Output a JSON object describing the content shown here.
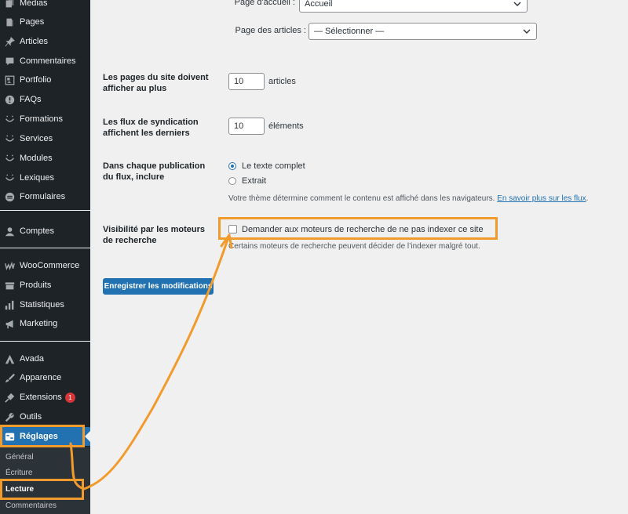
{
  "sidebar": {
    "items": [
      {
        "label": "Médias",
        "icon": "media-icon"
      },
      {
        "label": "Pages",
        "icon": "pages-icon"
      },
      {
        "label": "Articles",
        "icon": "pin-icon"
      },
      {
        "label": "Commentaires",
        "icon": "comment-icon"
      },
      {
        "label": "Portfolio",
        "icon": "portfolio-icon"
      },
      {
        "label": "FAQs",
        "icon": "info-icon"
      },
      {
        "label": "Formations",
        "icon": "smile-icon"
      },
      {
        "label": "Services",
        "icon": "smile-icon"
      },
      {
        "label": "Modules",
        "icon": "smile-icon"
      },
      {
        "label": "Lexiques",
        "icon": "smile-icon"
      },
      {
        "label": "Formulaires",
        "icon": "forms-icon"
      },
      {
        "label": "Comptes",
        "icon": "user-icon"
      },
      {
        "label": "WooCommerce",
        "icon": "woocommerce-icon"
      },
      {
        "label": "Produits",
        "icon": "products-icon"
      },
      {
        "label": "Statistiques",
        "icon": "stats-icon"
      },
      {
        "label": "Marketing",
        "icon": "megaphone-icon"
      },
      {
        "label": "Avada",
        "icon": "avada-icon"
      },
      {
        "label": "Apparence",
        "icon": "brush-icon"
      },
      {
        "label": "Extensions",
        "icon": "plugin-icon",
        "badge": "1"
      },
      {
        "label": "Outils",
        "icon": "wrench-icon"
      },
      {
        "label": "Réglages",
        "icon": "settings-icon",
        "active": true
      }
    ],
    "submenu": [
      "Général",
      "Écriture",
      "Lecture",
      "Commentaires"
    ],
    "current_submenu": "Lecture"
  },
  "form": {
    "homepage_label": "Page d'accueil :",
    "homepage_value": "Accueil",
    "posts_page_label": "Page des articles :",
    "posts_page_value": "— Sélectionner —",
    "posts_per_page_label": "Les pages du site doivent afficher au plus",
    "posts_per_page_value": "10",
    "posts_per_page_unit": "articles",
    "feed_label": "Les flux de syndication affichent les derniers",
    "feed_value": "10",
    "feed_unit": "éléments",
    "feed_content_label": "Dans chaque publication du flux, inclure",
    "radio_full": "Le texte complet",
    "radio_excerpt": "Extrait",
    "theme_desc": "Votre thème détermine comment le contenu est affiché dans les navigateurs.",
    "theme_link": "En savoir plus sur les flux",
    "search_visibility_label": "Visibilité par les moteurs de recherche",
    "noindex_label": "Demander aux moteurs de recherche de ne pas indexer ce site",
    "noindex_desc": "Certains moteurs de recherche peuvent décider de l’indexer malgré tout.",
    "save_button": "Enregistrer les modifications"
  },
  "colors": {
    "sidebar_bg": "#1d2327",
    "accent": "#2271b1",
    "annotation": "#f29b2d",
    "badge": "#d63638"
  }
}
